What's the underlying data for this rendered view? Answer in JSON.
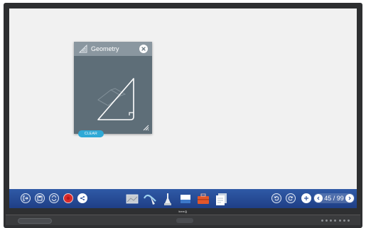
{
  "widget": {
    "title": "Geometry",
    "clear_label": "CLEAR",
    "header_icon": "set-square-icon",
    "close_icon": "close-icon"
  },
  "taskbar": {
    "left_buttons": [
      {
        "name": "exit-icon"
      },
      {
        "name": "save-icon"
      },
      {
        "name": "switch-icon"
      },
      {
        "name": "record-icon"
      },
      {
        "name": "share-icon"
      }
    ],
    "tools": [
      {
        "name": "background-icon"
      },
      {
        "name": "pen-icon"
      },
      {
        "name": "highlighter-icon"
      },
      {
        "name": "eraser-icon"
      },
      {
        "name": "toolbox-icon"
      },
      {
        "name": "pages-icon"
      }
    ],
    "undo_icon": "undo-icon",
    "redo_icon": "redo-icon",
    "add_page_icon": "add-page-icon",
    "page_count": "45 / 99"
  },
  "bezel": {
    "brand": "benQ"
  },
  "colors": {
    "taskbar": "#2a4f9b",
    "widget_header": "#8a97a0",
    "widget_body": "#5e6e78",
    "clear_button": "#2fa9d6",
    "record": "#d82a2a"
  }
}
